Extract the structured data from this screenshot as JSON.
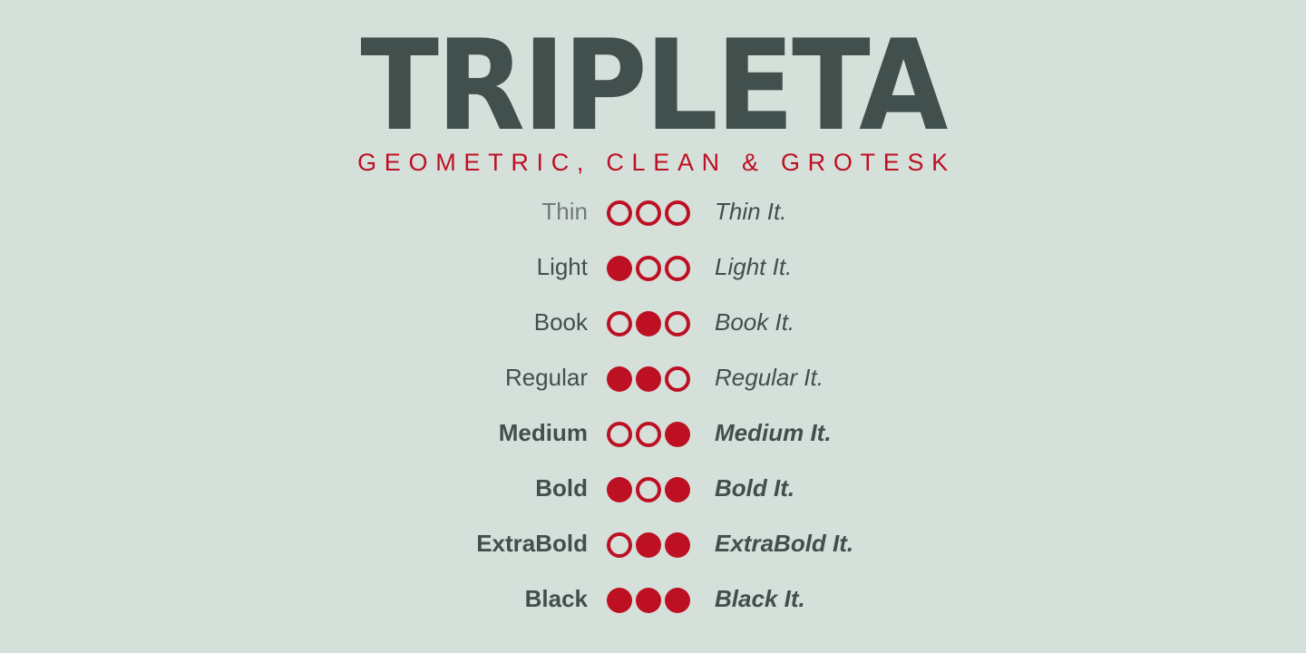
{
  "colors": {
    "background": "#d6e0db",
    "text": "#414f4d",
    "accent": "#bd1023"
  },
  "title": "TRIPLETA",
  "subtitle": "GEOMETRIC, CLEAN & GROTESK",
  "weights": [
    {
      "name": "Thin",
      "italic": "Thin It.",
      "dots": [
        false,
        false,
        false
      ]
    },
    {
      "name": "Light",
      "italic": "Light It.",
      "dots": [
        true,
        false,
        false
      ]
    },
    {
      "name": "Book",
      "italic": "Book It.",
      "dots": [
        false,
        true,
        false
      ]
    },
    {
      "name": "Regular",
      "italic": "Regular It.",
      "dots": [
        true,
        true,
        false
      ]
    },
    {
      "name": "Medium",
      "italic": "Medium It.",
      "dots": [
        false,
        false,
        true
      ]
    },
    {
      "name": "Bold",
      "italic": "Bold It.",
      "dots": [
        true,
        false,
        true
      ]
    },
    {
      "name": "ExtraBold",
      "italic": "ExtraBold It.",
      "dots": [
        false,
        true,
        true
      ]
    },
    {
      "name": "Black",
      "italic": "Black It.",
      "dots": [
        true,
        true,
        true
      ]
    }
  ]
}
